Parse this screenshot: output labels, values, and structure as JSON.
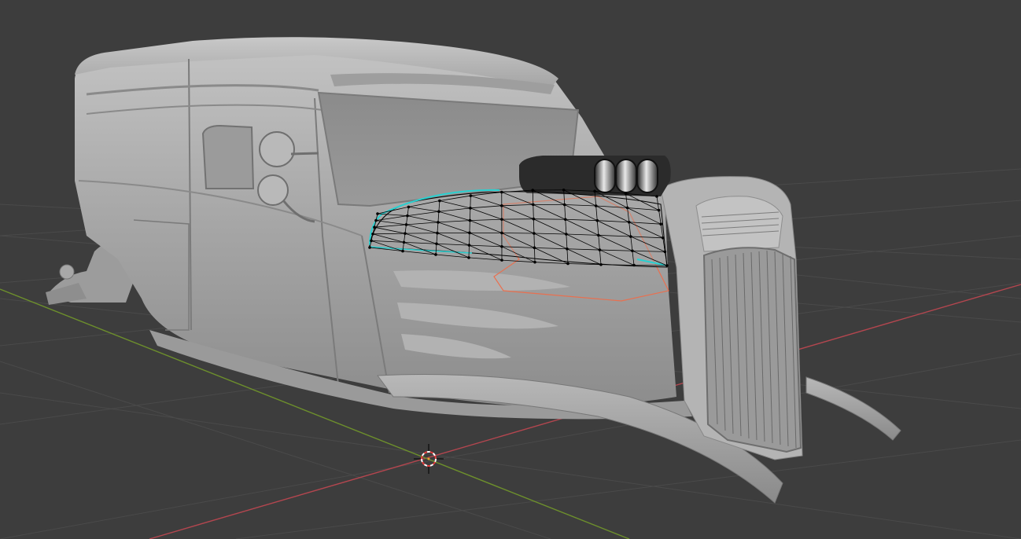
{
  "viewport": {
    "background": "#3d3d3d",
    "grid_color": "#4a4a4a",
    "x_axis_color": "#b3464f",
    "y_axis_color": "#6d8f2c"
  },
  "object": {
    "body_color": "#a7a7a7",
    "shadow_color": "#7e7e7e",
    "highlight_color": "#cfcfcf",
    "selection_outline_color": "#e87050",
    "active_edge_color": "#29d0d0",
    "mesh_wire_color": "#000000"
  },
  "cursor": {
    "icon": "3d-cursor-icon",
    "ring_color_a": "#e63c3c",
    "ring_color_b": "#ffffff"
  }
}
